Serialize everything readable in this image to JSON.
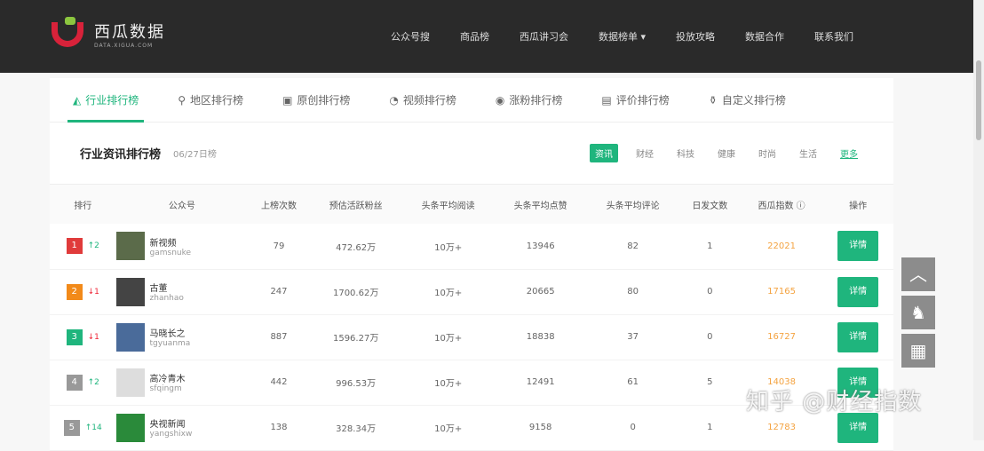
{
  "brand": {
    "name": "西瓜数据",
    "sub": "DATA.XIGUA.COM"
  },
  "nav": [
    "公众号搜",
    "商品榜",
    "西瓜讲习会",
    "数据榜单 ▾",
    "投放攻略",
    "数据合作",
    "联系我们"
  ],
  "tabs": [
    {
      "icon": "◭",
      "label": "行业排行榜"
    },
    {
      "icon": "⚲",
      "label": "地区排行榜"
    },
    {
      "icon": "▣",
      "label": "原创排行榜"
    },
    {
      "icon": "◔",
      "label": "视频排行榜"
    },
    {
      "icon": "◉",
      "label": "涨粉排行榜"
    },
    {
      "icon": "▤",
      "label": "评价排行榜"
    },
    {
      "icon": "⚱",
      "label": "自定义排行榜"
    }
  ],
  "board": {
    "title": "行业资讯排行榜",
    "date": "06/27日榜",
    "filters": [
      "资讯",
      "财经",
      "科技",
      "健康",
      "时尚",
      "生活"
    ],
    "more": "更多"
  },
  "columns": [
    "排行",
    "公众号",
    "上榜次数",
    "预估活跃粉丝",
    "头条平均阅读",
    "头条平均点赞",
    "头条平均评论",
    "日发文数",
    "西瓜指数",
    "操作"
  ],
  "colors": {
    "accent": "#1fb57d",
    "rank": [
      "#e03b3b",
      "#f28a1a",
      "#1fb57d",
      "#999999",
      "#999999"
    ]
  },
  "rows": [
    {
      "rank": "1",
      "change": "↑2",
      "dir": "up",
      "name": "新视频",
      "id": "gamsnuke",
      "times": "79",
      "fans": "472.62万",
      "read": "10万+",
      "like": "13946",
      "comment": "82",
      "posts": "1",
      "index": "22021",
      "action": "详情"
    },
    {
      "rank": "2",
      "change": "↓1",
      "dir": "down",
      "name": "古董",
      "id": "zhanhao",
      "times": "247",
      "fans": "1700.62万",
      "read": "10万+",
      "like": "20665",
      "comment": "80",
      "posts": "0",
      "index": "17165",
      "action": "详情"
    },
    {
      "rank": "3",
      "change": "↓1",
      "dir": "down",
      "name": "马晓长之",
      "id": "tgyuanma",
      "times": "887",
      "fans": "1596.27万",
      "read": "10万+",
      "like": "18838",
      "comment": "37",
      "posts": "0",
      "index": "16727",
      "action": "详情"
    },
    {
      "rank": "4",
      "change": "↑2",
      "dir": "up",
      "name": "高冷青木",
      "id": "sfqingm",
      "times": "442",
      "fans": "996.53万",
      "read": "10万+",
      "like": "12491",
      "comment": "61",
      "posts": "5",
      "index": "14038",
      "action": "详情"
    },
    {
      "rank": "5",
      "change": "↑14",
      "dir": "up",
      "name": "央视新闻",
      "id": "yangshixw",
      "times": "138",
      "fans": "328.34万",
      "read": "10万+",
      "like": "9158",
      "comment": "0",
      "posts": "1",
      "index": "12783",
      "action": "详情"
    }
  ],
  "float": {
    "top": "︿",
    "qq": "♞",
    "qr": "▦"
  },
  "watermark": "知乎 @财经指数"
}
